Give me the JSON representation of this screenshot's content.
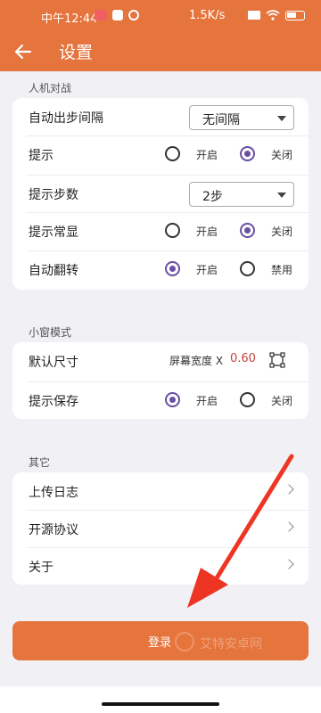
{
  "status_bar": {
    "time": "中午12:44",
    "network_speed": "1.5K/s"
  },
  "app_bar": {
    "title": "设置"
  },
  "sections": {
    "pvp": {
      "label": "人机对战",
      "auto_step_interval": {
        "label": "自动出步间隔",
        "value": "无间隔"
      },
      "hint": {
        "label": "提示",
        "on": "开启",
        "off": "关闭",
        "selected": "off"
      },
      "hint_steps": {
        "label": "提示步数",
        "value": "2步"
      },
      "hint_always": {
        "label": "提示常显",
        "on": "开启",
        "off": "关闭",
        "selected": "off"
      },
      "auto_flip": {
        "label": "自动翻转",
        "on": "开启",
        "off": "禁用",
        "selected": "on"
      }
    },
    "mini_window": {
      "label": "小窗模式",
      "default_size": {
        "label": "默认尺寸",
        "ratio_prefix": "屏幕宽度 X",
        "ratio_value": "0.60"
      },
      "hint_save": {
        "label": "提示保存",
        "on": "开启",
        "off": "关闭",
        "selected": "on"
      }
    },
    "other": {
      "label": "其它",
      "items": [
        "上传日志",
        "开源协议",
        "关于"
      ]
    }
  },
  "login_button": {
    "label": "登录"
  },
  "watermark": {
    "text": "艾特安卓网"
  },
  "colors": {
    "accent": "#e5743d",
    "radio_selected": "#6a4fa3",
    "ratio_value": "#c94040",
    "annotation_arrow": "#ee3524"
  }
}
